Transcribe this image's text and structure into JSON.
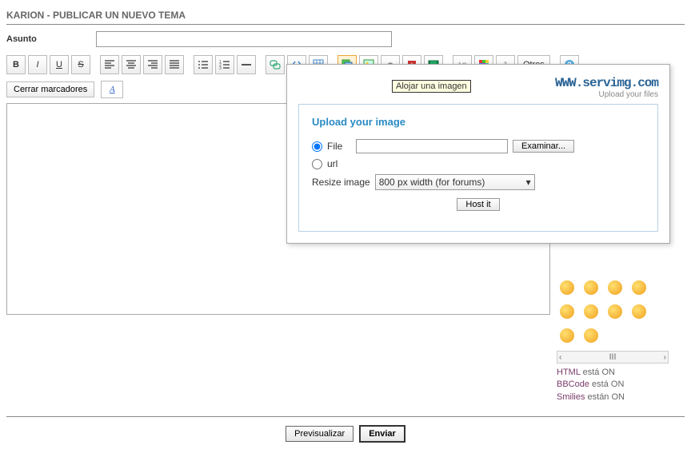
{
  "page": {
    "title": "KARION - PUBLICAR UN NUEVO TEMA",
    "subject_label": "Asunto",
    "subject_value": "",
    "close_markers": "Cerrar marcadores",
    "font_glyph": "A"
  },
  "toolbar": {
    "bold": "B",
    "italic": "I",
    "underline": "U",
    "strike": "S",
    "others": "Otros"
  },
  "tooltip": "Alojar una imagen",
  "popup": {
    "logo": "WWW.servimg.com",
    "tagline": "Upload your files",
    "heading": "Upload your image",
    "file_label": "File",
    "url_label": "url",
    "browse": "Examinar...",
    "resize_label": "Resize image",
    "resize_value": "800 px width (for forums)",
    "host_it": "Host it"
  },
  "status": {
    "html_label": "HTML",
    "html_state": "está ON",
    "bbcode_label": "BBCode",
    "bbcode_state": "está ON",
    "smilies_label": "Smilies",
    "smilies_state": "están ON"
  },
  "footer": {
    "preview": "Previsualizar",
    "send": "Enviar"
  },
  "scroll": {
    "left": "‹",
    "mid": "ⅠⅠⅠ",
    "right": "›"
  }
}
